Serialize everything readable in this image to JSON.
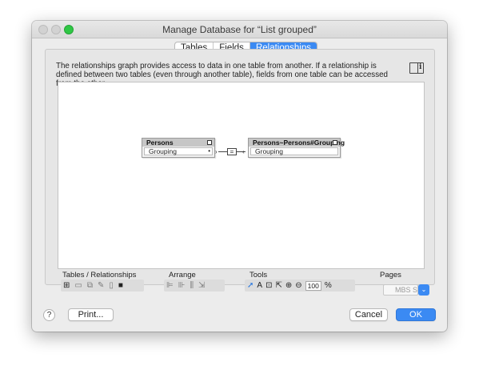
{
  "window": {
    "title": "Manage Database for “List grouped”"
  },
  "tabs": [
    {
      "label": "Tables",
      "active": false
    },
    {
      "label": "Fields",
      "active": false
    },
    {
      "label": "Relationships",
      "active": true
    }
  ],
  "description": "The relationships graph provides access to data in one table from another. If a relationship is defined between two tables (even through another table), fields from one table can be accessed from the other.",
  "graph": {
    "tables": [
      {
        "name": "Persons",
        "field": "Grouping"
      },
      {
        "name": "Persons~Persons#Grouping",
        "field": "Grouping"
      }
    ],
    "relation_operator": "="
  },
  "toolbar": {
    "groups": {
      "tables": "Tables / Relationships",
      "arrange": "Arrange",
      "tools": "Tools",
      "pages": "Pages"
    },
    "zoom": "100",
    "zoom_unit": "%",
    "pages_overlay": "MBS S"
  },
  "buttons": {
    "help": "?",
    "print": "Print...",
    "cancel": "Cancel",
    "ok": "OK"
  },
  "colors": {
    "accent": "#3b8af3",
    "zoom_button": "#2fc745"
  }
}
